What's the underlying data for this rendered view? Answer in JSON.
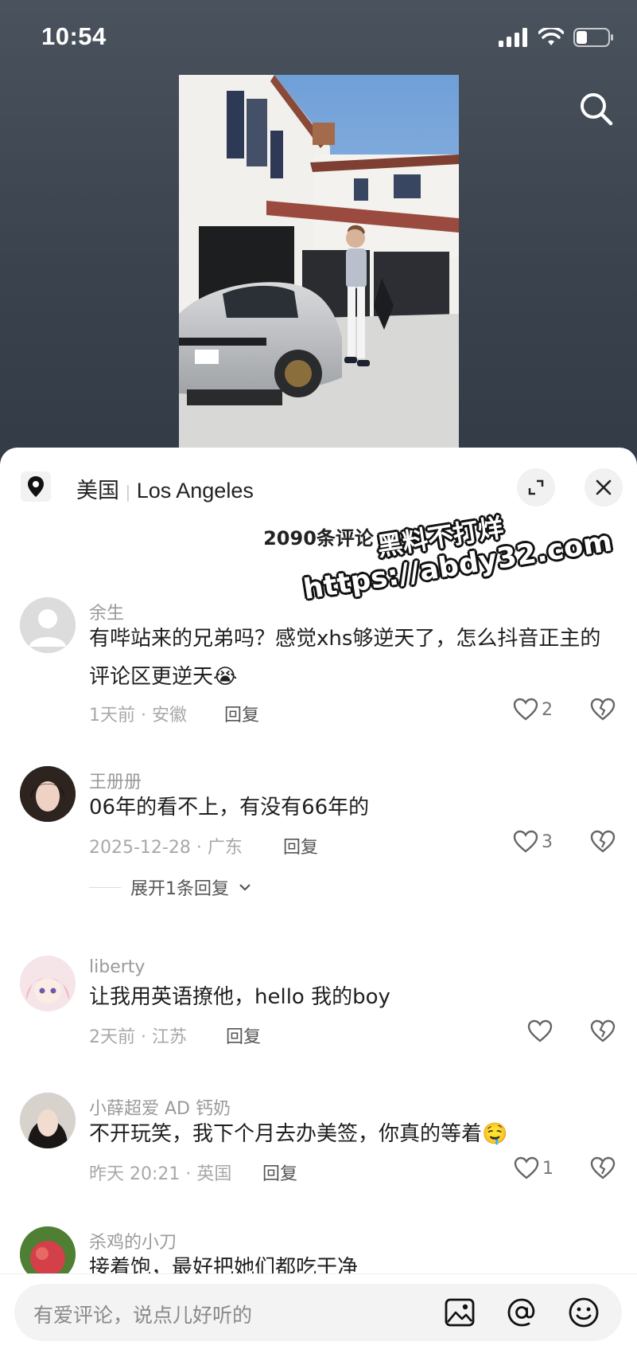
{
  "status_bar": {
    "time": "10:54",
    "icons": [
      "signal-icon",
      "wifi-icon",
      "battery-icon"
    ]
  },
  "top": {
    "search_icon": "search-icon"
  },
  "sheet": {
    "location": {
      "country": "美国",
      "city": "Los Angeles"
    },
    "comment_count_label": "2090条评论",
    "watermark": {
      "line1": "黑料不打烊",
      "line2": "https://abdy32.com"
    },
    "comments": [
      {
        "username": "余生",
        "text": "有哔站来的兄弟吗？感觉xhs够逆天了，怎么抖音正主的评论区更逆天😭",
        "time_loc": "1天前 · 安徽",
        "reply_label": "回复",
        "likes": "2"
      },
      {
        "username": "王册册",
        "text": "06年的看不上，有没有66年的",
        "time_loc": "2025-12-28 · 广东",
        "reply_label": "回复",
        "likes": "3",
        "expand_label": "展开1条回复"
      },
      {
        "username": "liberty",
        "text": "让我用英语撩他，hello 我的boy",
        "time_loc": "2天前 · 江苏",
        "reply_label": "回复",
        "likes": ""
      },
      {
        "username": "小薛超爱 AD 钙奶",
        "text": "不开玩笑，我下个月去办美签，你真的等着🤤",
        "time_loc": "昨天 20:21 · 英国",
        "reply_label": "回复",
        "likes": "1"
      },
      {
        "username": "杀鸡的小刀",
        "text": "接着饱，最好把她们都吃干净",
        "time_loc": "",
        "reply_label": "",
        "likes": ""
      }
    ]
  },
  "input_bar": {
    "placeholder": "有爱评论，说点儿好听的",
    "icons": [
      "image-icon",
      "at-icon",
      "emoji-icon"
    ]
  },
  "colors": {
    "background_top": "#3a424d",
    "sheet": "#ffffff",
    "text_primary": "#1f1f1f",
    "text_secondary": "#9a9a9a"
  }
}
